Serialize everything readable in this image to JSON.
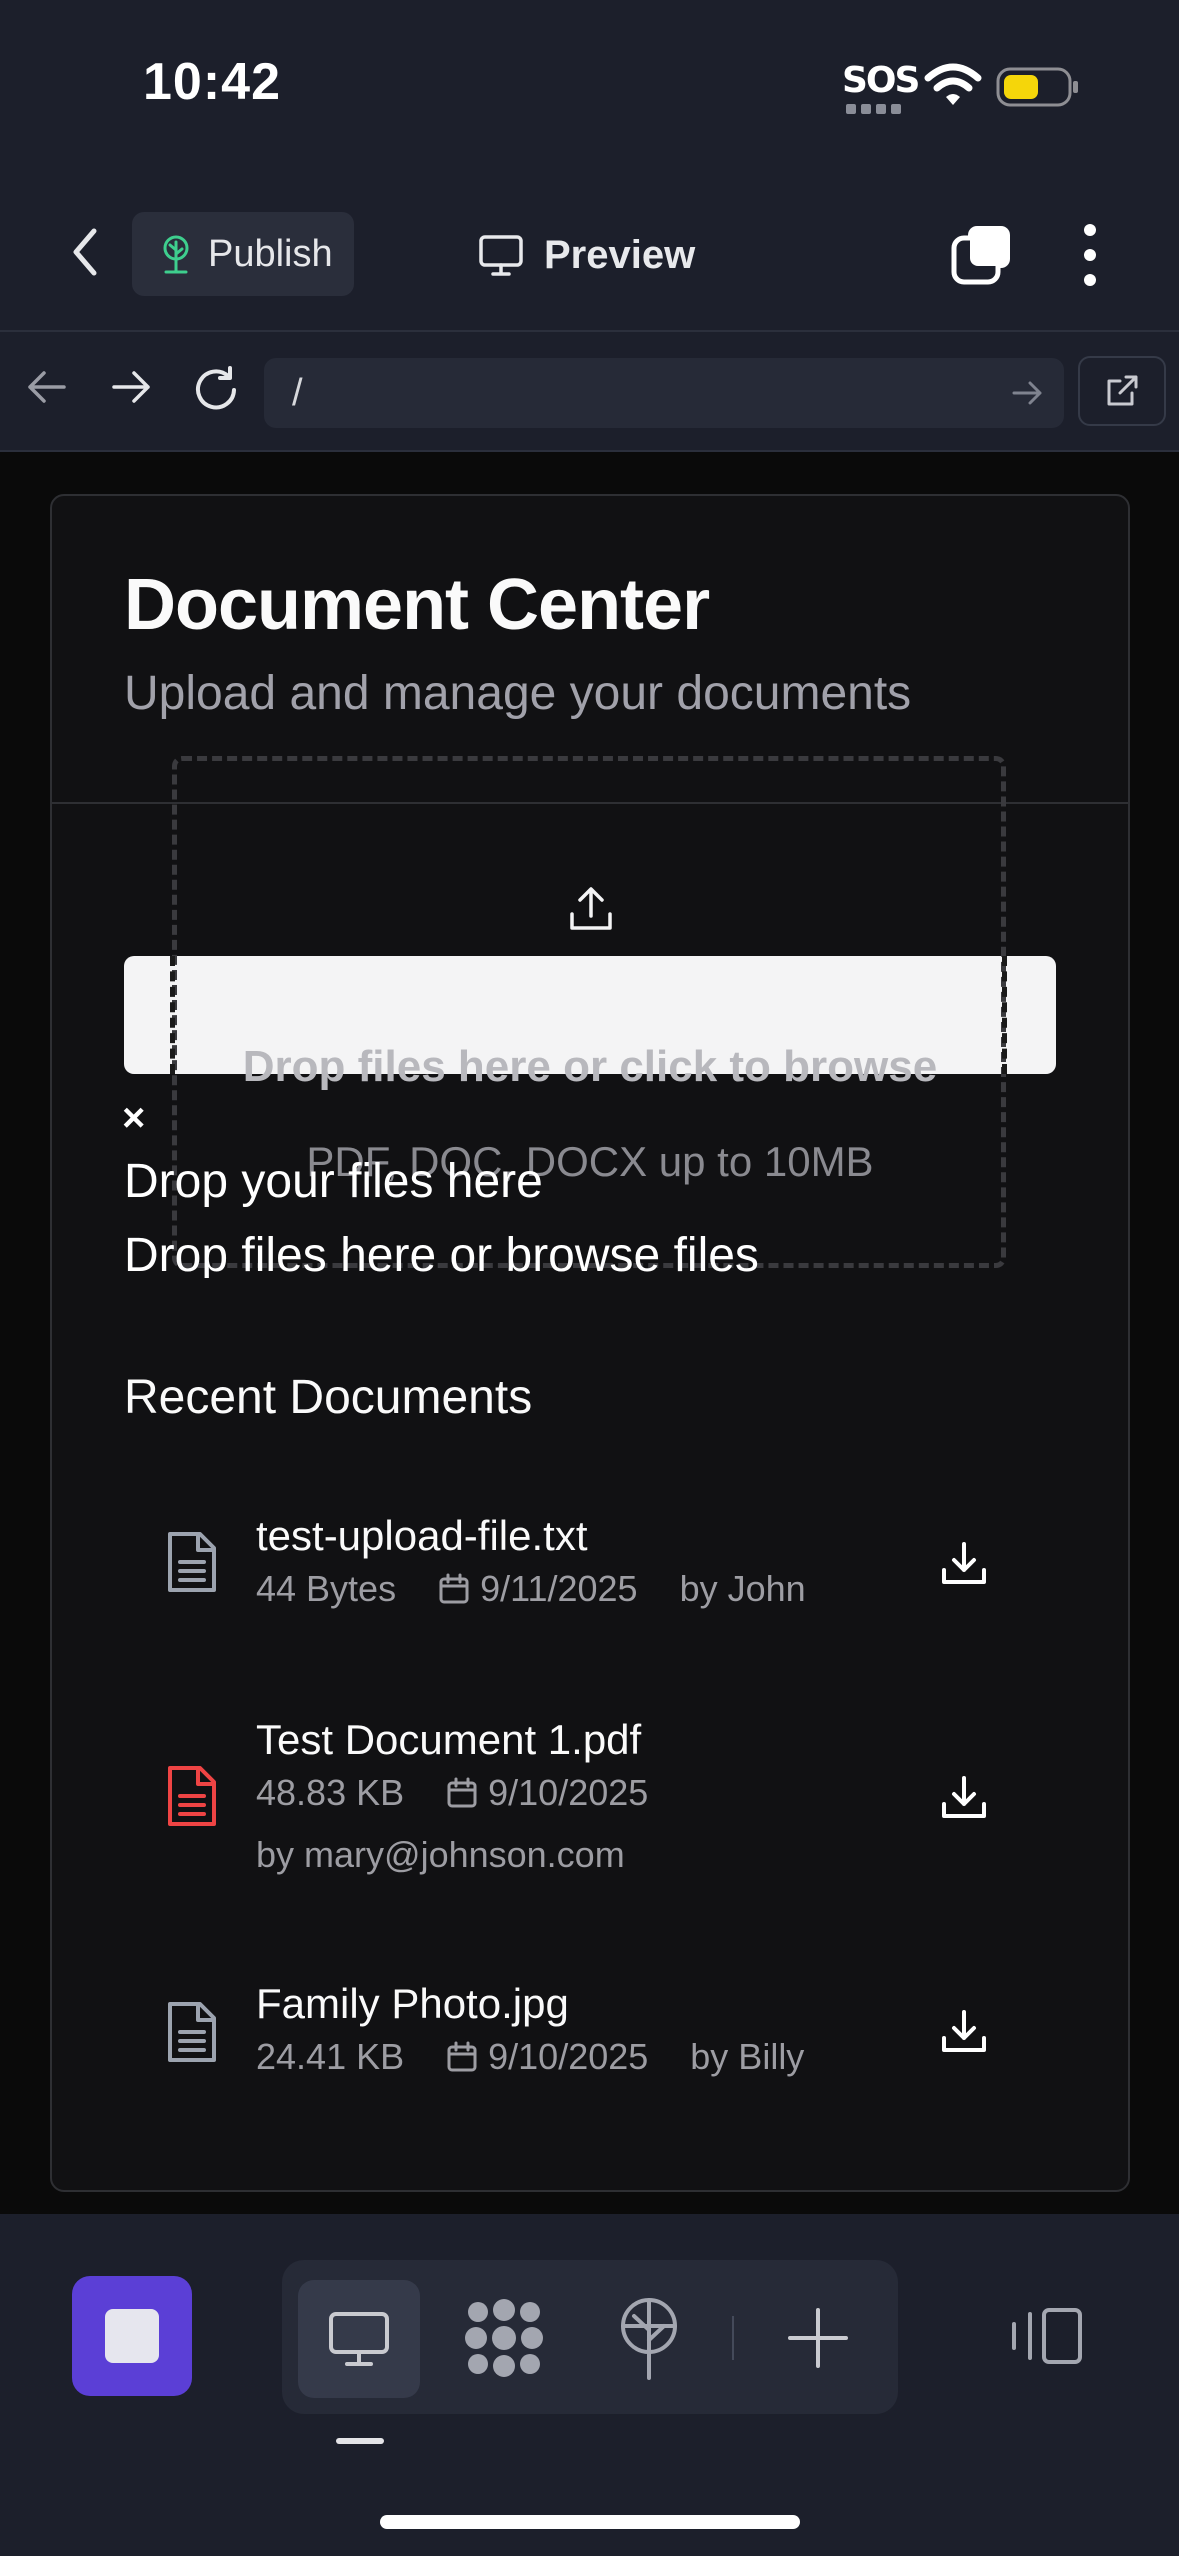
{
  "status_bar": {
    "time": "10:42",
    "sos": "SOS"
  },
  "top_bar": {
    "publish_label": "Publish",
    "preview_label": "Preview"
  },
  "browser": {
    "url": "/"
  },
  "page": {
    "title": "Document Center",
    "subtitle": "Upload and manage your documents"
  },
  "upload": {
    "primary": "Drop files here or click to browse",
    "secondary": "PDF, DOC, DOCX up to 10MB",
    "close_glyph": "×",
    "overlay_title": "Drop your files here",
    "overlay_desc": "Drop files here or browse files"
  },
  "recent": {
    "title": "Recent Documents",
    "documents": [
      {
        "name": "test-upload-file.txt",
        "size": "44 Bytes",
        "date": "9/11/2025",
        "author": "by John",
        "icon": "file-text-icon",
        "icon_color": "#9ca3af"
      },
      {
        "name": "Test Document 1.pdf",
        "size": "48.83 KB",
        "date": "9/10/2025",
        "author": "by mary@johnson.com",
        "icon": "file-pdf-icon",
        "icon_color": "#ef4444"
      },
      {
        "name": "Family Photo.jpg",
        "size": "24.41 KB",
        "date": "9/10/2025",
        "author": "by Billy",
        "icon": "file-text-icon",
        "icon_color": "#9ca3af"
      }
    ]
  },
  "colors": {
    "accent": "#5b3fd6",
    "chrome_bg": "#1c1f2b",
    "content_bg": "#0a0a0a",
    "card_bg": "#111113",
    "battery": "#f5d60a"
  }
}
